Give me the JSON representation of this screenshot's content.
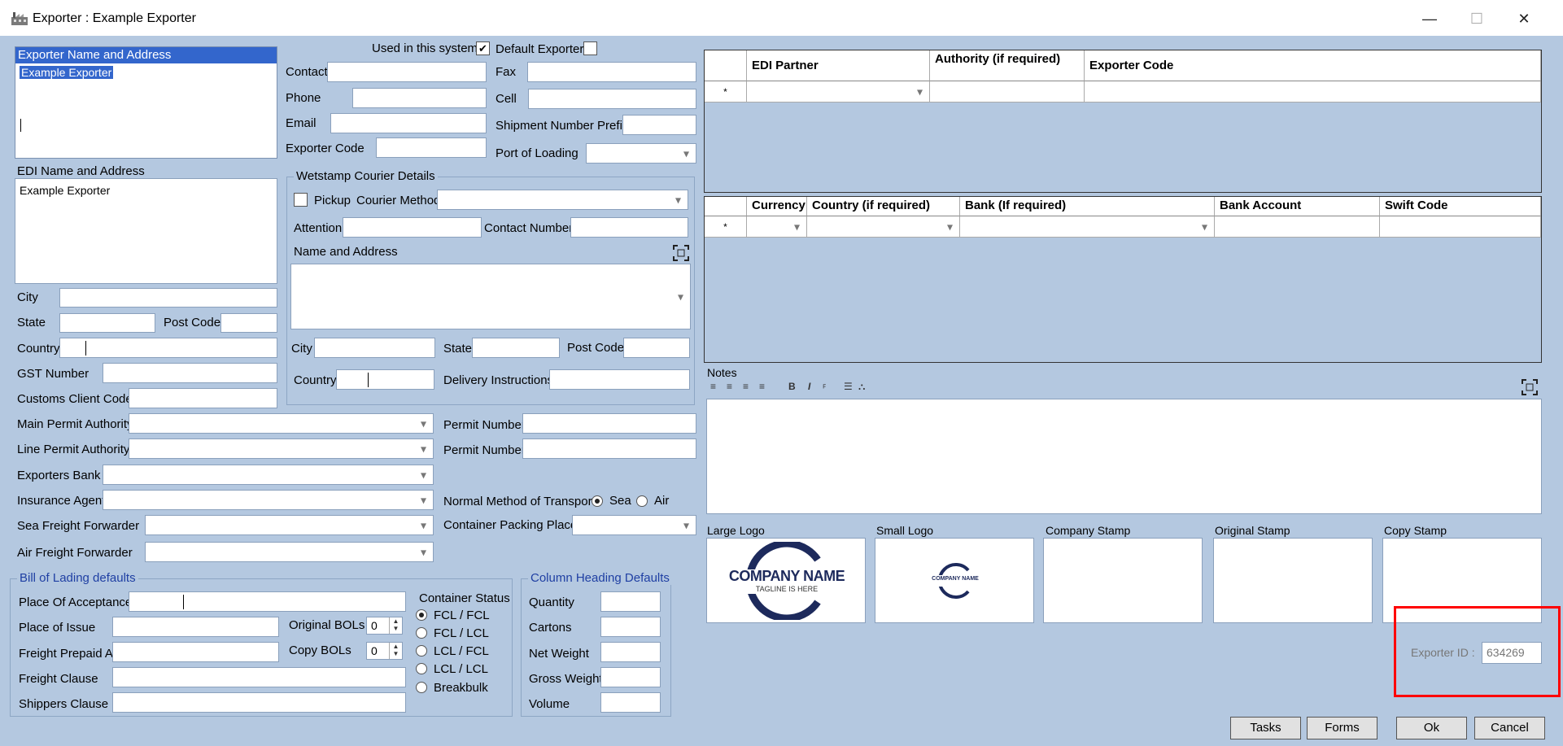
{
  "window": {
    "title": "Exporter : Example Exporter",
    "minimize": "—",
    "maximize": "☐",
    "close": "✕"
  },
  "left": {
    "name_addr_label": "Exporter Name and Address",
    "name_addr_value": "Example Exporter",
    "edi_label": "EDI Name and Address",
    "edi_value": "Example Exporter",
    "city_label": "City",
    "state_label": "State",
    "postcode_label": "Post Code",
    "country_label": "Country",
    "gst_label": "GST Number",
    "customs_label": "Customs Client Code",
    "main_permit_label": "Main Permit Authority",
    "line_permit_label": "Line Permit Authority",
    "bank_label": "Exporters Bank",
    "insurance_label": "Insurance Agent",
    "sea_ff_label": "Sea Freight Forwarder",
    "air_ff_label": "Air Freight Forwarder"
  },
  "mid": {
    "used_label": "Used in this system",
    "default_label": "Default Exporter",
    "contact_label": "Contact",
    "fax_label": "Fax",
    "phone_label": "Phone",
    "cell_label": "Cell",
    "email_label": "Email",
    "ship_prefix_label": "Shipment Number Prefix",
    "exporter_code_label": "Exporter Code",
    "port_label": "Port of Loading",
    "permit1_label": "Permit Number",
    "permit2_label": "Permit Number",
    "transport_label": "Normal Method of Transport",
    "sea_label": "Sea",
    "air_label": "Air",
    "container_place_label": "Container Packing Place"
  },
  "wetstamp": {
    "title": "Wetstamp Courier Details",
    "pickup_label": "Pickup",
    "courier_label": "Courier Method",
    "attention_label": "Attention",
    "contact_no_label": "Contact Number",
    "name_addr_label": "Name and Address",
    "city_label": "City",
    "state_label": "State",
    "postcode_label": "Post Code",
    "country_label": "Country",
    "delivery_label": "Delivery Instructions"
  },
  "bol": {
    "title": "Bill of Lading defaults",
    "acceptance_label": "Place Of Acceptance",
    "issue_label": "Place of Issue",
    "prepaid_label": "Freight Prepaid At",
    "clause_label": "Freight Clause",
    "shippers_label": "Shippers Clause",
    "orig_bols_label": "Original BOLs",
    "orig_bols_value": "0",
    "copy_bols_label": "Copy BOLs",
    "copy_bols_value": "0",
    "container_status_label": "Container Status",
    "status_options": [
      "FCL / FCL",
      "FCL / LCL",
      "LCL / FCL",
      "LCL / LCL",
      "Breakbulk"
    ]
  },
  "colhead": {
    "title": "Column Heading Defaults",
    "labels": [
      "Quantity",
      "Cartons",
      "Net Weight",
      "Gross Weight",
      "Volume"
    ]
  },
  "edi_grid": {
    "headers": [
      "EDI Partner",
      "Authority (if required)",
      "Exporter Code"
    ],
    "row_marker": "*"
  },
  "bank_grid": {
    "headers": [
      "Currency",
      "Country (if required)",
      "Bank (If required)",
      "Bank Account",
      "Swift Code"
    ],
    "row_marker": "*"
  },
  "notes": {
    "label": "Notes"
  },
  "logos": {
    "large_label": "Large Logo",
    "small_label": "Small Logo",
    "company_stamp_label": "Company Stamp",
    "original_stamp_label": "Original Stamp",
    "copy_stamp_label": "Copy Stamp",
    "logo_text": "COMPANY NAME",
    "logo_tagline": "TAGLINE IS HERE"
  },
  "footer": {
    "exporter_id_label": "Exporter ID :",
    "exporter_id_value": "634269",
    "tasks": "Tasks",
    "forms": "Forms",
    "ok": "Ok",
    "cancel": "Cancel"
  },
  "colors": {
    "window_bg": "#b4c8e0",
    "highlight": "#ff0000",
    "selection": "#3366cc"
  }
}
